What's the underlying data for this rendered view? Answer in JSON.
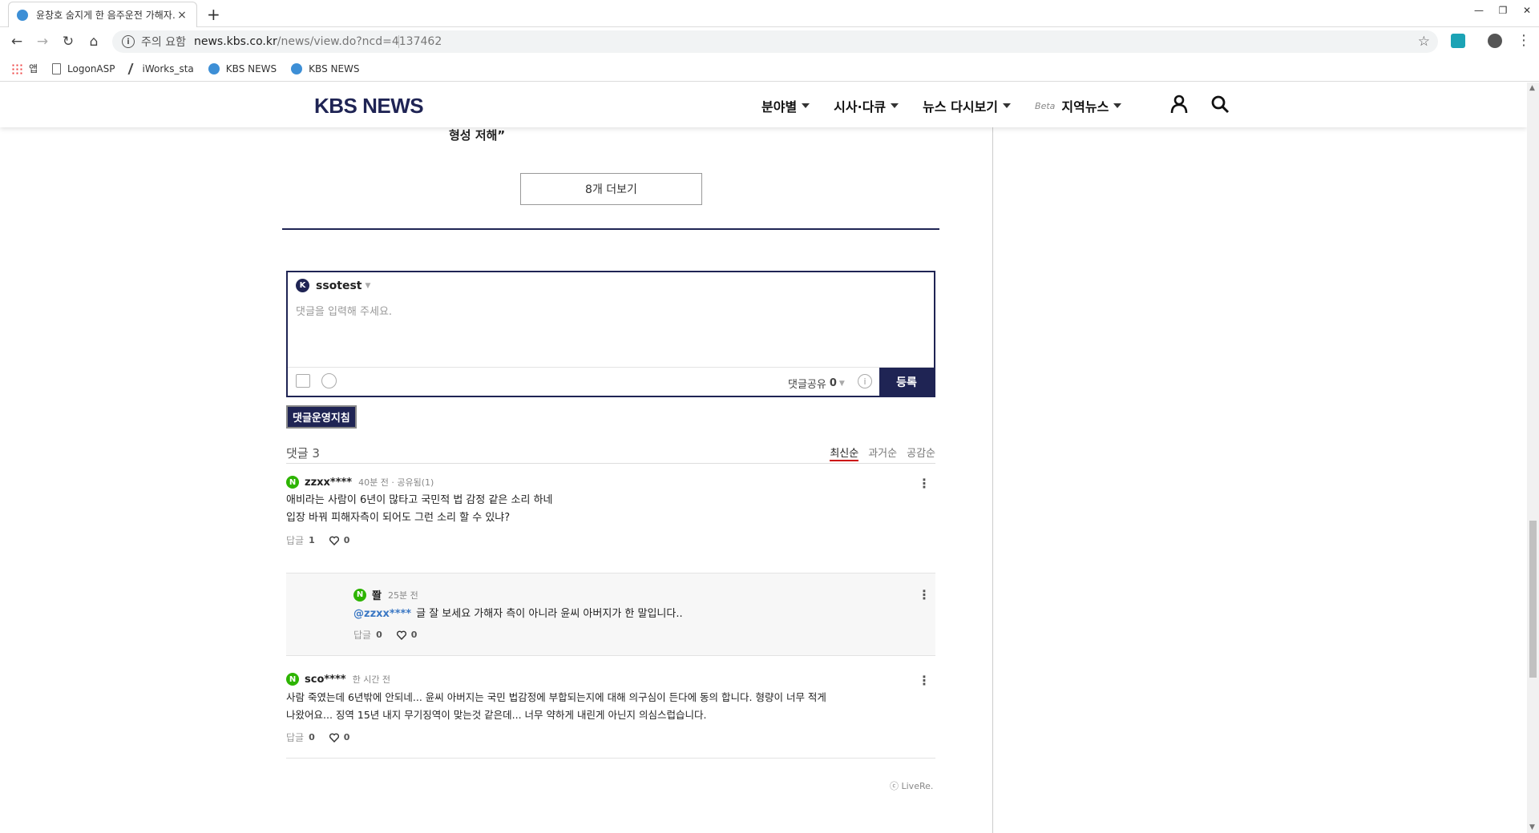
{
  "browser": {
    "tab_title": "윤창호 숨지게 한 음주운전 가해자…",
    "tab_close": "×",
    "new_tab": "+",
    "url_warning": "주의 요함",
    "url_host": "news.kbs.co.kr",
    "url_path": "/news/view.do?ncd=4137462",
    "bookmarks": [
      "앱",
      "LogonASP",
      "iWorks_sta",
      "KBS NEWS",
      "KBS NEWS"
    ],
    "icons": [
      "back-icon",
      "forward-icon",
      "reload-icon",
      "home-icon",
      "star-icon",
      "profile-icon",
      "menu-icon"
    ]
  },
  "header": {
    "logo": "KBS NEWS",
    "menu": [
      "분야별",
      "시사·다큐",
      "뉴스 다시보기",
      "지역뉴스"
    ],
    "beta": "Beta"
  },
  "article": {
    "headline_tail": "형성 저해”",
    "more_button": "8개 더보기"
  },
  "compose": {
    "badge": "K",
    "username": "ssotest",
    "placeholder": "댓글을 입력해 주세요.",
    "share_label": "댓글공유",
    "share_count": "0",
    "help": "i",
    "submit": "등록"
  },
  "policy_button": "댓글운영지침",
  "list": {
    "count_label": "댓글 3",
    "sort": [
      "최신순",
      "과거순",
      "공감순"
    ],
    "active_sort": "최신순"
  },
  "comments": [
    {
      "badge": "N",
      "user": "zzxx****",
      "time": "40분 전 · 공유됨(1)",
      "lines": [
        "애비라는 사람이 6년이 많타고 국민적 법 감정 같은 소리 하네",
        "입장 바꿔 피해자측이 되어도 그런 소리 할 수 있냐?"
      ],
      "reply_label": "답글",
      "reply_count": "1",
      "like_count": "0"
    },
    {
      "badge": "N",
      "user": "쫠",
      "time": "25분 전",
      "mention": "@zzxx****",
      "text": "글 잘 보세요 가해자 측이 아니라 윤씨 아버지가 한 말입니다..",
      "reply_label": "답글",
      "reply_count": "0",
      "like_count": "0"
    },
    {
      "badge": "N",
      "user": "sco****",
      "time": "한 시간 전",
      "lines": [
        "사람 죽였는데 6년밖에 안되네... 윤씨 아버지는 국민 법감정에 부합되는지에 대해 의구심이 든다에 동의 합니다. 형량이 너무 적게",
        "나왔어요... 징역 15년 내지 무기징역이 맞는것 같은데... 너무 약하게 내린게 아닌지 의심스럽습니다."
      ],
      "reply_label": "답글",
      "reply_count": "0",
      "like_count": "0"
    }
  ],
  "footer": {
    "livere": "ⓒ LiveRe."
  }
}
